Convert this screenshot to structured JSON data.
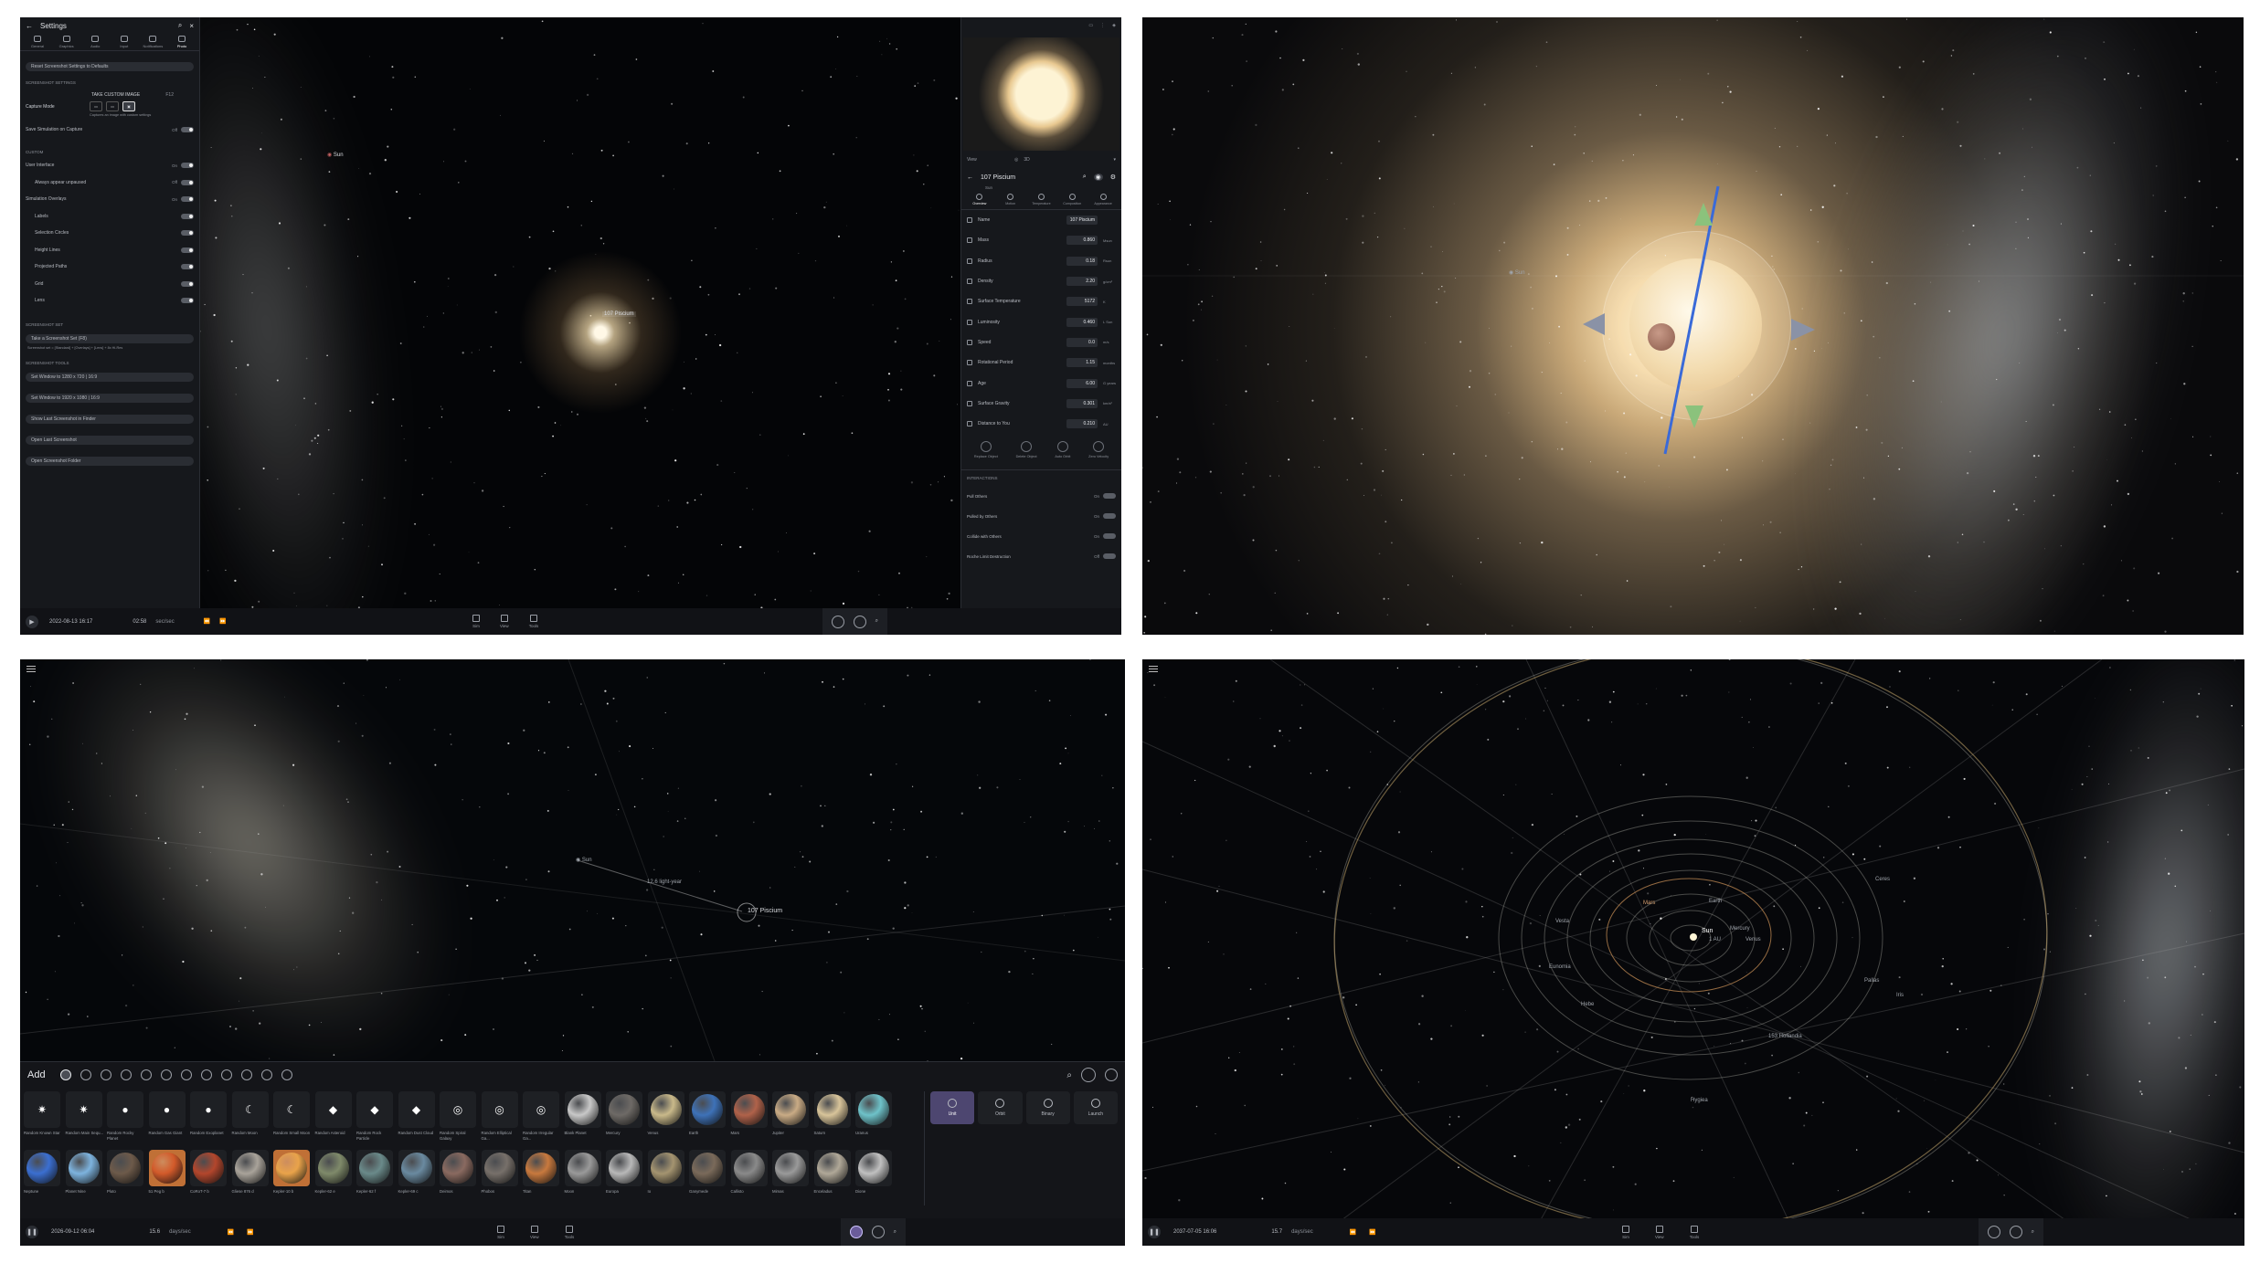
{
  "panel1": {
    "settings": {
      "title": "Settings",
      "tabs": [
        "General",
        "Graphics",
        "Audio",
        "Input",
        "Notifications",
        "Photo"
      ],
      "reset_label": "Reset Screenshot Settings to Defaults",
      "section_screenshot": "Screenshot Settings",
      "take_custom_label": "TAKE CUSTOM IMAGE",
      "take_custom_key": "F12",
      "capture_mode_label": "Capture Mode",
      "capture_modes": [
        "Window",
        "Screenshot",
        "Custom"
      ],
      "capture_note": "Captures an image with custom settings",
      "save_sim_label": "Save Simulation on Capture",
      "save_sim_value": "Off",
      "section_custom": "Custom",
      "rows": [
        {
          "label": "User Interface",
          "value": "On",
          "sub": false
        },
        {
          "label": "Always appear unpaused",
          "value": "Off",
          "sub": true
        },
        {
          "label": "Simulation Overlays",
          "value": "On",
          "sub": false
        },
        {
          "label": "Labels",
          "value": "",
          "sub": true
        },
        {
          "label": "Selection Circles",
          "value": "",
          "sub": true
        },
        {
          "label": "Height Lines",
          "value": "",
          "sub": true
        },
        {
          "label": "Projected Paths",
          "value": "",
          "sub": true
        },
        {
          "label": "Grid",
          "value": "",
          "sub": true
        },
        {
          "label": "Lens",
          "value": "",
          "sub": true
        }
      ],
      "section_set": "Screenshot Set",
      "take_set_label": "Take a Screenshot Set (F8)",
      "set_note": "Screenshot set = [Standard] + [Overlays] + [Lens] + 8x Hi-Res",
      "section_tools": "Screenshot Tools",
      "tools": [
        "Set Window to 1280 x 720 | 16:9",
        "Set Window to 1920 x 1080 | 16:9",
        "Show Last Screenshot in Finder",
        "Open Last Screenshot",
        "Open Screenshot Folder"
      ]
    },
    "labels": {
      "sun": "Sun",
      "star": "107 Piscium"
    },
    "object": {
      "view_label": "View",
      "view_mode": "3D",
      "name": "107 Piscium",
      "subtitle": "Sun",
      "tabs": [
        "Overview",
        "Motion",
        "Temperature",
        "Composition",
        "Appearance"
      ],
      "properties": [
        {
          "label": "Name",
          "value": "107 Piscium",
          "unit": ""
        },
        {
          "label": "Mass",
          "value": "0.860",
          "unit": "Msun"
        },
        {
          "label": "Radius",
          "value": "0.18",
          "unit": "Rsun"
        },
        {
          "label": "Density",
          "value": "2.20",
          "unit": "g/cm³"
        },
        {
          "label": "Surface Temperature",
          "value": "5172",
          "unit": "K"
        },
        {
          "label": "Luminosity",
          "value": "0.460",
          "unit": "L Sun"
        },
        {
          "label": "Speed",
          "value": "0.0",
          "unit": "m/s"
        },
        {
          "label": "Rotational Period",
          "value": "1.15",
          "unit": "months"
        },
        {
          "label": "Age",
          "value": "6.00",
          "unit": "G years"
        },
        {
          "label": "Surface Gravity",
          "value": "0.301",
          "unit": "km/s²"
        },
        {
          "label": "Distance to You",
          "value": "0.210",
          "unit": "AU"
        }
      ],
      "actions": [
        "Replace Object",
        "Delete Object",
        "Auto Orbit",
        "Zero Velocity"
      ],
      "interactions_title": "Interactions",
      "interactions": [
        {
          "label": "Pull Others",
          "value": "On"
        },
        {
          "label": "Pulled by Others",
          "value": "On"
        },
        {
          "label": "Collide with Others",
          "value": "On"
        },
        {
          "label": "Roche Limit Destruction",
          "value": "Off"
        }
      ]
    },
    "bottom": {
      "date": "2022-08-13 16:17",
      "speed": "02:58",
      "speed_unit": "sec/sec",
      "tools": [
        "Sim",
        "View",
        "Tools"
      ]
    }
  },
  "panel2": {
    "labels": {
      "sun": "Sun"
    }
  },
  "panel3": {
    "labels": {
      "sun": "Sun",
      "distance": "12.6 light-year",
      "star": "107 Piscium"
    },
    "add": {
      "title": "Add",
      "row1": [
        {
          "name": "Random Known Star",
          "kind": "star"
        },
        {
          "name": "Random Main Sequ...",
          "kind": "star"
        },
        {
          "name": "Random Rocky Planet",
          "kind": "dot"
        },
        {
          "name": "Random Gas Giant",
          "kind": "dot"
        },
        {
          "name": "Random Exoplanet",
          "kind": "dot"
        },
        {
          "name": "Random Moon",
          "kind": "moon"
        },
        {
          "name": "Random Small Moon",
          "kind": "moon"
        },
        {
          "name": "Random Asteroid",
          "kind": "rock"
        },
        {
          "name": "Random Rock Particle",
          "kind": "rock"
        },
        {
          "name": "Random Dust Cloud",
          "kind": "rock"
        },
        {
          "name": "Random Spiral Galaxy",
          "kind": "galaxy"
        },
        {
          "name": "Random Elliptical Ga...",
          "kind": "galaxy"
        },
        {
          "name": "Random Irregular Ga...",
          "kind": "galaxy"
        },
        {
          "name": "Blank Planet",
          "kind": "planet"
        },
        {
          "name": "Mercury",
          "kind": "planet"
        },
        {
          "name": "Venus",
          "kind": "planet"
        },
        {
          "name": "Earth",
          "kind": "planet"
        },
        {
          "name": "Mars",
          "kind": "planet"
        },
        {
          "name": "Jupiter",
          "kind": "planet"
        },
        {
          "name": "Saturn",
          "kind": "planet"
        },
        {
          "name": "Uranus",
          "kind": "planet"
        }
      ],
      "row2": [
        "Neptune",
        "Planet Nine",
        "Pluto",
        "51 Peg b",
        "CoRoT-7 b",
        "Gliese 876 d",
        "Kepler-10 b",
        "Kepler-62 e",
        "Kepler-62 f",
        "Kepler-69 c",
        "Deimos",
        "Phobos",
        "Titan",
        "Moon",
        "Europa",
        "Io",
        "Ganymede",
        "Callisto",
        "Mimas",
        "Enceladus",
        "Dione"
      ],
      "side": [
        "Unit",
        "Orbit",
        "Binary",
        "Launch"
      ]
    },
    "bottom": {
      "date": "2026-09-12 06:04",
      "speed": "15.6",
      "speed_unit": "days/sec",
      "tools": [
        "Sim",
        "View",
        "Tools"
      ]
    }
  },
  "panel4": {
    "labels": [
      {
        "id": "sun",
        "text": "Sun"
      },
      {
        "id": "mercury",
        "text": "Mercury"
      },
      {
        "id": "venus",
        "text": "Venus"
      },
      {
        "id": "earth",
        "text": "Earth"
      },
      {
        "id": "mars",
        "text": "Mars"
      },
      {
        "id": "vesta",
        "text": "Vesta"
      },
      {
        "id": "ceres",
        "text": "Ceres"
      },
      {
        "id": "eunomia",
        "text": "Eunomia"
      },
      {
        "id": "hebe",
        "text": "Hebe"
      },
      {
        "id": "pallas",
        "text": "Pallas"
      },
      {
        "id": "iris",
        "text": "Iris"
      },
      {
        "id": "hygiea",
        "text": "Hygiea"
      },
      {
        "id": "halley",
        "text": "153 Hollandia"
      },
      {
        "id": "au",
        "text": "1 AU"
      }
    ],
    "bottom": {
      "date": "2037-07-05 16:06",
      "speed": "15.7",
      "speed_unit": "days/sec",
      "tools": [
        "Sim",
        "View",
        "Tools"
      ]
    }
  },
  "colors": {
    "accent": "#6a5c9a",
    "panel_bg": "#16181c",
    "orbit": "#c8b88a"
  }
}
